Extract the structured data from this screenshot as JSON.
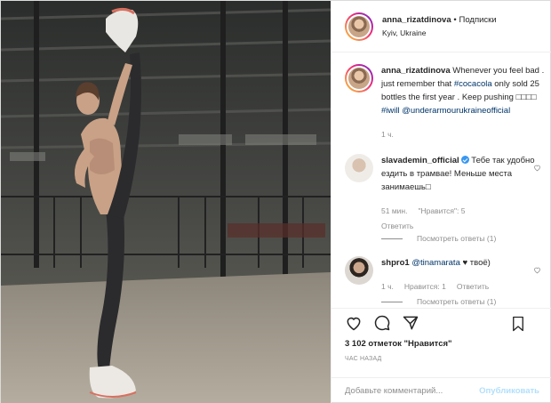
{
  "header": {
    "username": "anna_rizatdinova",
    "separator": "•",
    "follow_label": "Подписки",
    "location": "Kyiv, Ukraine"
  },
  "caption": {
    "username": "anna_rizatdinova",
    "text_before": "Whenever you feel bad . just remember that ",
    "hashtag_cocacola": "#cocacola",
    "text_middle": " only sold 25 bottles the first year . Keep pushing ",
    "emojis": "□□□□",
    "hashtag_iwill": "#iwill",
    "mention": "@underarmourukraineofficial",
    "time": "1 ч."
  },
  "comments": [
    {
      "username": "slavademin_official",
      "verified": true,
      "text": "Тебе так удобно ездить в трамвае! Меньше места занимаешь□",
      "time": "51 мин.",
      "likes": "\"Нравится\": 5",
      "reply_label": "Ответить",
      "view_replies": "Посмотреть ответы (1)"
    },
    {
      "username": "shpro1",
      "mention": "@tinamarata",
      "text_after": "♥ твоё)",
      "time": "1 ч.",
      "likes": "Нравится: 1",
      "reply_label": "Ответить",
      "view_replies": "Посмотреть ответы (1)"
    }
  ],
  "actions": {
    "like_icon": "heart-icon",
    "comment_icon": "comment-icon",
    "share_icon": "share-icon",
    "save_icon": "bookmark-icon"
  },
  "likes": {
    "count": "3 102 отметок",
    "label": "\"Нравится\""
  },
  "timeago": "ЧАС НАЗАД",
  "add_comment": {
    "placeholder": "Добавьте комментарий...",
    "post_label": "Опубликовать"
  },
  "colors": {
    "link": "#003569",
    "muted": "#8e8e8e",
    "post_disabled": "#b2dffc",
    "verified": "#3897f0"
  }
}
